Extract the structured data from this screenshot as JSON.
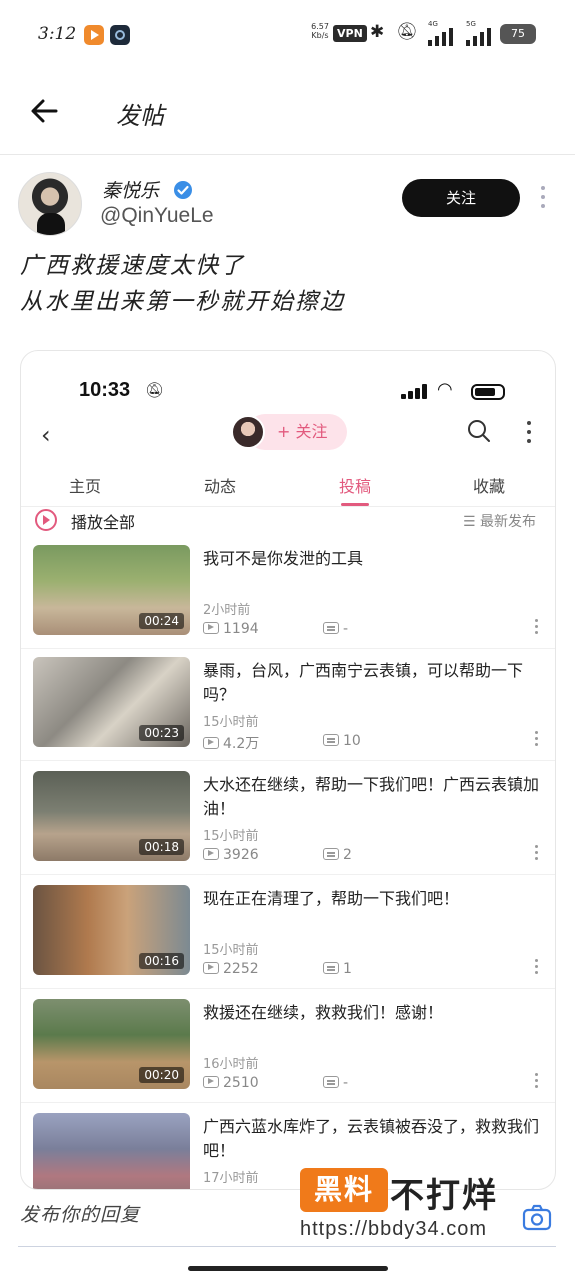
{
  "status_bar": {
    "time": "3:12",
    "net_speed_value": "6.57",
    "net_speed_unit": "Kb/s",
    "vpn": "VPN",
    "sig1": "4G",
    "sig2": "5G",
    "battery": "75"
  },
  "header": {
    "title": "发帖"
  },
  "author": {
    "name": "秦悦乐",
    "handle": "@QinYueLe",
    "follow_label": "关注"
  },
  "post": {
    "line1": "广西救援速度太快了",
    "line2": "从水里出来第一秒就开始擦边"
  },
  "embedded": {
    "time": "10:33",
    "follow_label": "+ 关注",
    "tabs": [
      "主页",
      "动态",
      "投稿",
      "收藏"
    ],
    "active_tab": "投稿",
    "play_all": "播放全部",
    "sort": "☰ 最新发布",
    "videos": [
      {
        "title": "我可不是你发泄的工具",
        "duration": "00:24",
        "time": "2小时前",
        "plays": "1194",
        "danmaku": "-"
      },
      {
        "title": "暴雨，台风，广西南宁云表镇，可以帮助一下吗？",
        "duration": "00:23",
        "time": "15小时前",
        "plays": "4.2万",
        "danmaku": "10"
      },
      {
        "title": "大水还在继续，帮助一下我们吧！广西云表镇加油！",
        "duration": "00:18",
        "time": "15小时前",
        "plays": "3926",
        "danmaku": "2"
      },
      {
        "title": "现在正在清理了，帮助一下我们吧！",
        "duration": "00:16",
        "time": "15小时前",
        "plays": "2252",
        "danmaku": "1"
      },
      {
        "title": "救援还在继续，救救我们！感谢！",
        "duration": "00:20",
        "time": "16小时前",
        "plays": "2510",
        "danmaku": "-"
      },
      {
        "title": "广西六蓝水库炸了，云表镇被吞没了，救救我们吧！",
        "duration": "",
        "time": "17小时前",
        "plays": "",
        "danmaku": ""
      }
    ]
  },
  "reply": {
    "placeholder": "发布你的回复"
  },
  "watermark": {
    "badge": "黑料",
    "text": "不打烊",
    "url": "https://bbdy34.com"
  }
}
